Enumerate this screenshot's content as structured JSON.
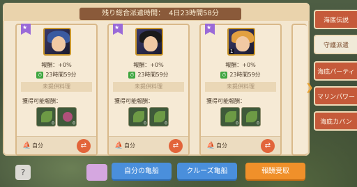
{
  "header": {
    "remaining_label": "残り総合派遣時間：",
    "remaining_value": "4日23時間58分"
  },
  "cards": [
    {
      "reward": "報酬：+0%",
      "time": "23時間59分",
      "food": "未提供料理",
      "obtain_label": "獲得可能報酬：",
      "owner": "自分",
      "level": "1",
      "hair_color": "#3a5aa0",
      "items": [
        {
          "icon": "leaf-icon",
          "count": "0"
        },
        {
          "icon": "flower-icon",
          "count": "0"
        }
      ]
    },
    {
      "reward": "報酬：+0%",
      "time": "23時間59分",
      "food": "未提供料理",
      "obtain_label": "獲得可能報酬：",
      "owner": "自分",
      "level": "1",
      "hair_color": "#1a1a1a",
      "items": [
        {
          "icon": "leaf-icon",
          "count": "0"
        },
        {
          "icon": "leaf-icon",
          "count": "0"
        }
      ]
    },
    {
      "reward": "報酬：+0%",
      "time": "23時間59分",
      "food": "未提供料理",
      "obtain_label": "獲得可能報酬：",
      "owner": "自分",
      "level": "1",
      "hair_color": "#e2a040",
      "items": [
        {
          "icon": "leaf-icon",
          "count": "0"
        },
        {
          "icon": "leaf-icon",
          "count": "0"
        }
      ]
    }
  ],
  "side_tabs": [
    {
      "label": "海底伝説",
      "active": false
    },
    {
      "label": "守護派遣",
      "active": true
    },
    {
      "label": "海底パーティ",
      "active": false
    },
    {
      "label": "マリンパワー",
      "active": false
    },
    {
      "label": "海底カバン",
      "active": false
    }
  ],
  "bottom": {
    "help": "?",
    "my_boat": "自分の亀船",
    "cruise_boat": "クルーズ亀船",
    "claim": "報酬受取"
  },
  "colors": {
    "blue_button": "#4a8fdc",
    "orange_button": "#f0902a",
    "tab_red": "#c55a3a"
  }
}
